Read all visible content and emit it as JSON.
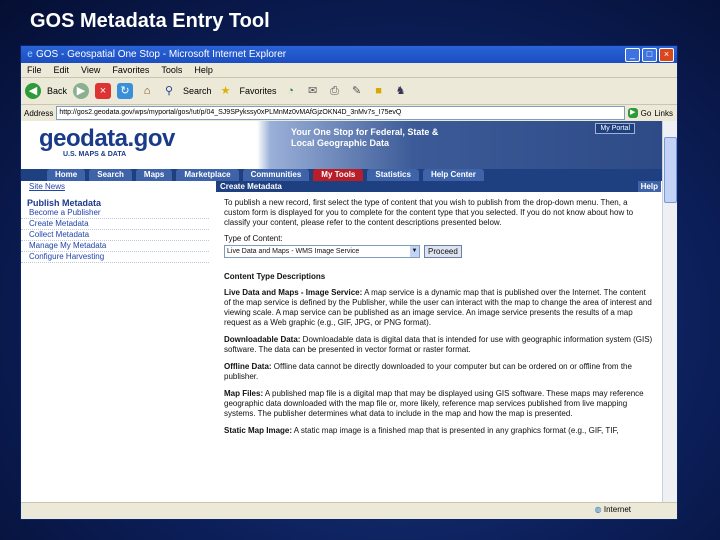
{
  "slide_title": "GOS Metadata Entry Tool",
  "window": {
    "title": "GOS - Geospatial One Stop - Microsoft Internet Explorer",
    "buttons": [
      "_",
      "□",
      "×"
    ]
  },
  "menu": [
    "File",
    "Edit",
    "View",
    "Favorites",
    "Tools",
    "Help"
  ],
  "toolbar": {
    "back_label": "Back",
    "search_label": "Search",
    "favorites_label": "Favorites"
  },
  "address": {
    "label": "Address",
    "value": "http://gos2.geodata.gov/wps/myportal/gos/!ut/p/04_SJ9SPykssy0xPLMnMz0vMAfGjzOKN4D_3nMv7s_I75evQ",
    "go": "Go",
    "links": "Links"
  },
  "banner": {
    "logo": "geodata.gov",
    "logo_sub": "U.S. MAPS & DATA",
    "tagline": "Your One Stop for Federal, State & Local Geographic Data",
    "my_portal": "My Portal"
  },
  "nav_tabs": [
    "Home",
    "Search",
    "Maps",
    "Marketplace",
    "Communities",
    "My Tools",
    "Statistics",
    "Help Center"
  ],
  "active_tab": "My Tools",
  "sidebar": {
    "site_news": "Site News",
    "heading": "Publish Metadata",
    "items": [
      "Become a Publisher",
      "Create Metadata",
      "Collect Metadata",
      "Manage My Metadata",
      "Configure Harvesting"
    ]
  },
  "panel": {
    "title": "Create Metadata",
    "help": "Help",
    "intro": "To publish a new record, first select the type of content that you wish to publish from the drop-down menu. Then, a custom form is displayed for you to complete for the content type that you selected. If you do not know about how to classify your content, please refer to the content descriptions presented below.",
    "type_label": "Type of Content:",
    "type_value": "Live Data and Maps - WMS Image Service",
    "proceed": "Proceed",
    "section_title": "Content Type Descriptions",
    "descriptions": [
      {
        "term": "Live Data and Maps - Image Service:",
        "text": " A map service is a dynamic map that is published over the Internet. The content of the map service is defined by the Publisher, while the user can interact with the map to change the area of interest and viewing scale. A map service can be published as an image service. An image service presents the results of a map request as a Web graphic (e.g., GIF, JPG, or PNG format)."
      },
      {
        "term": "Downloadable Data:",
        "text": " Downloadable data is digital data that is intended for use with geographic information system (GIS) software. The data can be presented in vector format or raster format."
      },
      {
        "term": "Offline Data:",
        "text": " Offline data cannot be directly downloaded to your computer but can be ordered on or offline from the publisher."
      },
      {
        "term": "Map Files:",
        "text": " A published map file is a digital map that may be displayed using GIS software. These maps may reference geographic data downloaded with the map file or, more likely, reference map services published from live mapping systems. The publisher determines what data to include in the map and how the map is presented."
      },
      {
        "term": "Static Map Image:",
        "text": " A static map image is a finished map that is presented in any graphics format (e.g., GIF, TIF,"
      }
    ]
  },
  "status": {
    "zone": "Internet"
  }
}
